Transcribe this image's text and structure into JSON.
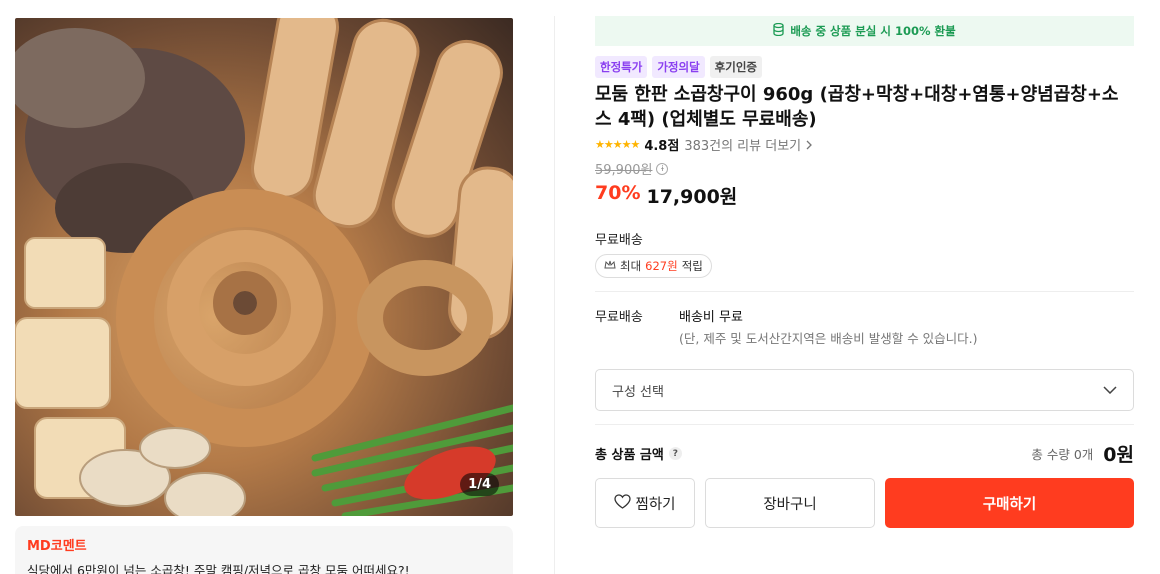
{
  "product_image": {
    "counter": "1/4",
    "alt_icon": "food-photo"
  },
  "md_comment": {
    "title": "MD코멘트",
    "text": "식당에서 6만원이 넘는 소곱창! 주말 캠핑/저녁으로 곱창 모둠 어떠세요?!"
  },
  "banner": {
    "icon": "coin-stack-icon",
    "text": "배송 중 상품 분실 시 100% 환불"
  },
  "badges": [
    {
      "label": "한정특가",
      "style": "purple"
    },
    {
      "label": "가정의달",
      "style": "purple"
    },
    {
      "label": "후기인증",
      "style": "gray"
    }
  ],
  "product": {
    "title": "모둠 한판 소곱창구이 960g (곱창+막창+대창+염통+양념곱창+소스 4팩) (업체별도 무료배송)",
    "rating_stars": 5,
    "rating_score": "4.8점",
    "review_link": "383건의 리뷰 더보기",
    "original_price": "59,900원",
    "discount": "70%",
    "price": "17,900원"
  },
  "shipping_summary": {
    "label": "무료배송",
    "point_prefix": "최대 ",
    "point_amount": "627원",
    "point_suffix": " 적립"
  },
  "shipping_detail": {
    "label": "무료배송",
    "main": "배송비 무료",
    "note": "(단, 제주 및 도서산간지역은 배송비 발생할 수 있습니다.)"
  },
  "option_select": {
    "placeholder": "구성 선택"
  },
  "total": {
    "label": "총 상품 금액",
    "help": "?",
    "quantity": "총 수량 0개",
    "price": "0원"
  },
  "buttons": {
    "like": "찜하기",
    "cart": "장바구니",
    "buy": "구매하기"
  },
  "colors": {
    "accent": "#ff3c1f",
    "banner_bg": "#edf9f1",
    "banner_text": "#1c9b54",
    "badge_purple": "#8a3ff0",
    "star": "#ffb400"
  }
}
